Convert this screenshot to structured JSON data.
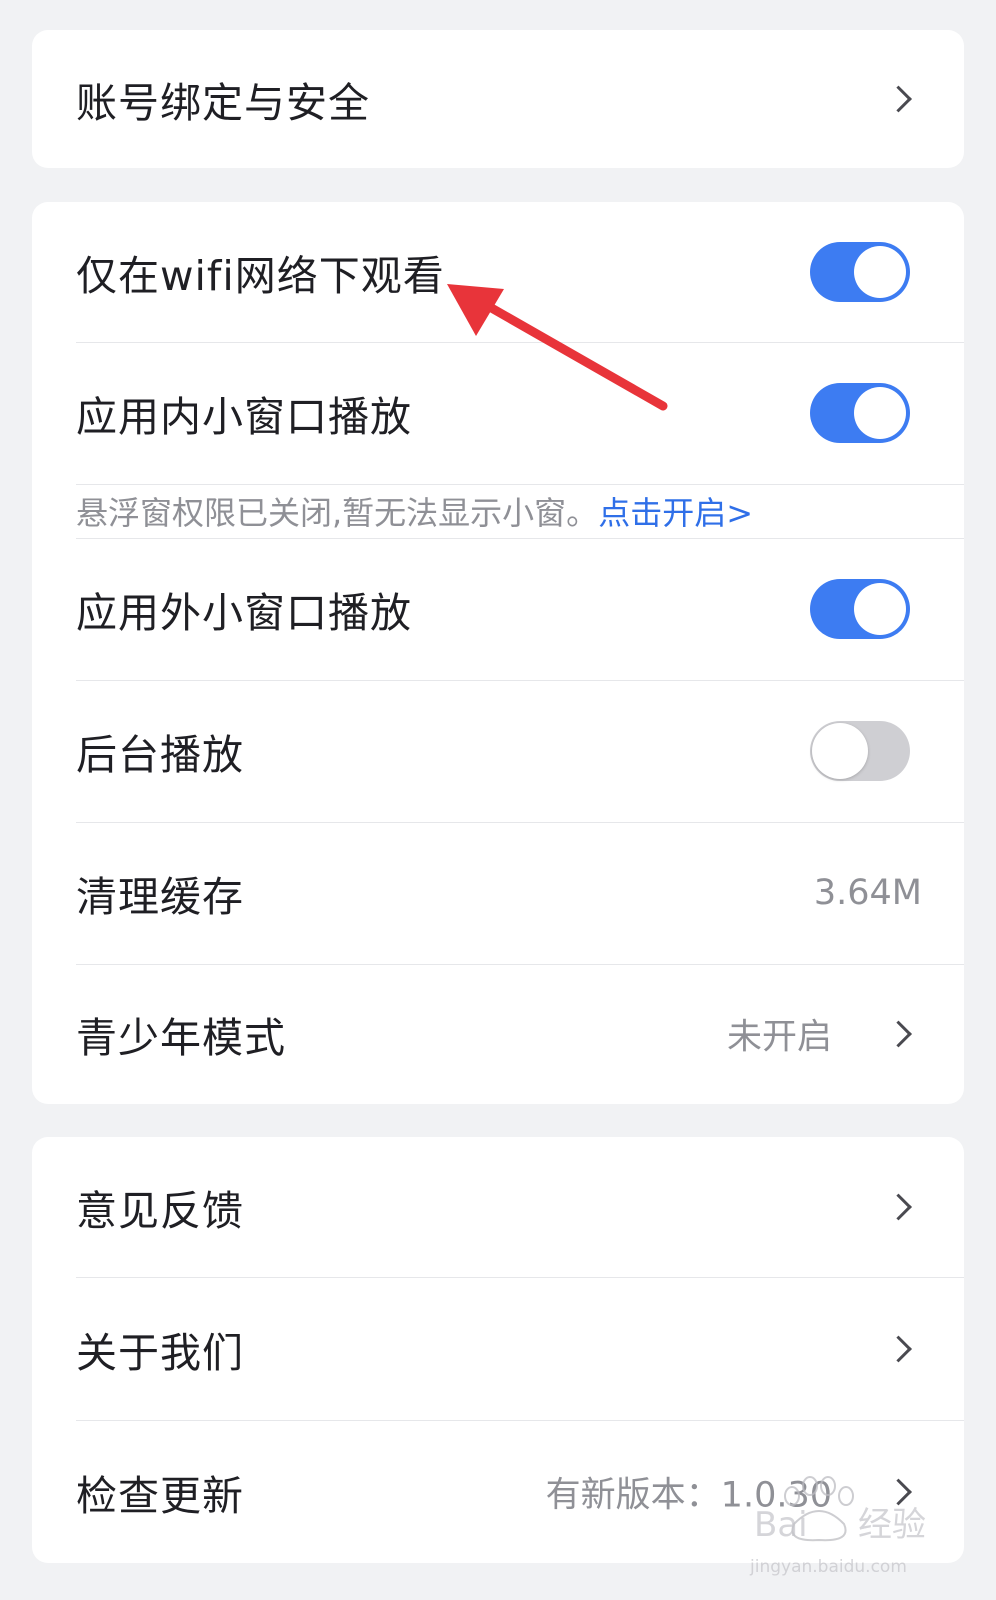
{
  "account_card": {
    "account_security_label": "账号绑定与安全"
  },
  "playback_card": {
    "wifi_only_label": "仅在wifi网络下观看",
    "wifi_only_enabled": true,
    "in_app_pip_label": "应用内小窗口播放",
    "in_app_pip_enabled": true,
    "permission_notice": "悬浮窗权限已关闭,暂无法显示小窗。",
    "permission_link": "点击开启>",
    "out_app_pip_label": "应用外小窗口播放",
    "out_app_pip_enabled": true,
    "background_play_label": "后台播放",
    "background_play_enabled": false,
    "clear_cache_label": "清理缓存",
    "cache_size": "3.64M",
    "teen_mode_label": "青少年模式",
    "teen_mode_status": "未开启"
  },
  "about_card": {
    "feedback_label": "意见反馈",
    "about_us_label": "关于我们",
    "check_update_label": "检查更新",
    "update_status": "有新版本：1.0.30"
  },
  "colors": {
    "accent": "#3d7cf2",
    "link": "#2f6fe8",
    "annotation_arrow": "#e8343a",
    "background": "#f1f2f4"
  },
  "watermark": {
    "brand": "Baidu经验",
    "url": "jingyan.baidu.com"
  }
}
